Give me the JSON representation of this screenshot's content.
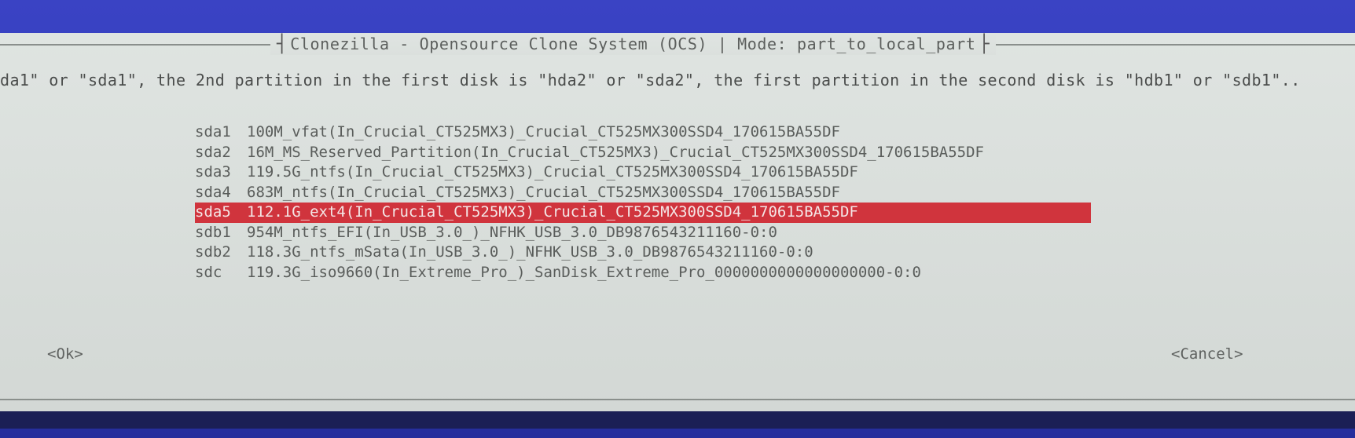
{
  "dialog": {
    "title": "Clonezilla - Opensource Clone System (OCS) | Mode: part_to_local_part",
    "hint": "da1\" or \"sda1\", the 2nd partition in the first disk is \"hda2\" or \"sda2\", the first partition in the second disk is \"hdb1\" or \"sdb1\"..",
    "selected_index": 4,
    "items": [
      {
        "device": "sda1",
        "description": "100M_vfat(In_Crucial_CT525MX3)_Crucial_CT525MX300SSD4_170615BA55DF"
      },
      {
        "device": "sda2",
        "description": "16M_MS_Reserved_Partition(In_Crucial_CT525MX3)_Crucial_CT525MX300SSD4_170615BA55DF"
      },
      {
        "device": "sda3",
        "description": "119.5G_ntfs(In_Crucial_CT525MX3)_Crucial_CT525MX300SSD4_170615BA55DF"
      },
      {
        "device": "sda4",
        "description": "683M_ntfs(In_Crucial_CT525MX3)_Crucial_CT525MX300SSD4_170615BA55DF"
      },
      {
        "device": "sda5",
        "description": "112.1G_ext4(In_Crucial_CT525MX3)_Crucial_CT525MX300SSD4_170615BA55DF"
      },
      {
        "device": "sdb1",
        "description": "954M_ntfs_EFI(In_USB_3.0_)_NFHK_USB_3.0_DB9876543211160-0:0"
      },
      {
        "device": "sdb2",
        "description": "118.3G_ntfs_mSata(In_USB_3.0_)_NFHK_USB_3.0_DB9876543211160-0:0"
      },
      {
        "device": "sdc",
        "description": "119.3G_iso9660(In_Extreme_Pro_)_SanDisk_Extreme_Pro_0000000000000000000-0:0"
      }
    ],
    "ok_label": "<Ok>",
    "cancel_label": "<Cancel>"
  },
  "colors": {
    "background": "#2f38b8",
    "dialog": "#dbe0dd",
    "selection": "#d0343d"
  }
}
